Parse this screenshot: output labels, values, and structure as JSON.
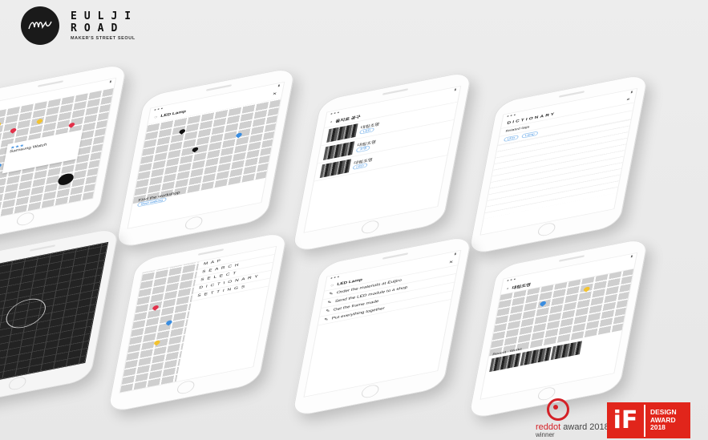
{
  "brand": {
    "logo_text": "euljiro",
    "line1": "EULJI",
    "line2": "ROAD",
    "tagline": "MAKER'S STREET SEOUL"
  },
  "screens": {
    "map_colored": {
      "card_title": "Samsung Watch",
      "fab_icon": "hand-icon"
    },
    "map_route": {
      "title": "LED Lamp",
      "caption": "Find the workshop",
      "button": "Start walking"
    },
    "list": {
      "header": "을지로 공구",
      "item": "대림조명",
      "tags": [
        "LED",
        "조명"
      ]
    },
    "dictionary": {
      "title": "DICTIONARY",
      "subtitle": "Related tags",
      "tags": [
        "LED",
        "Lamp"
      ]
    },
    "splash": {
      "logo_text": "euljiro"
    },
    "menu": {
      "items": [
        "M A P",
        "S E A R C H",
        "S E L E C T",
        "D I C T I O N A R Y",
        "S E T T I N G S"
      ]
    },
    "steps": {
      "title": "LED Lamp",
      "steps": [
        "Order the materials at Euljiro",
        "Send the LED module to a shop",
        "Get the frame made",
        "Put everything together"
      ]
    },
    "detail": {
      "header": "대림조명",
      "footer_a": "Recent",
      "footer_b": "Works"
    }
  },
  "awards": {
    "reddot_a": "reddot",
    "reddot_b": " award 2018",
    "reddot_winner": "winner",
    "if_logo": "iF",
    "if_l1": "DESIGN",
    "if_l2": "AWARD",
    "if_l3": "2018"
  },
  "colors": {
    "accent": "#3a8de0",
    "reddot": "#d42127",
    "if_red": "#e1251b",
    "pin_yellow": "#f2c230",
    "pin_red": "#e2314a"
  }
}
